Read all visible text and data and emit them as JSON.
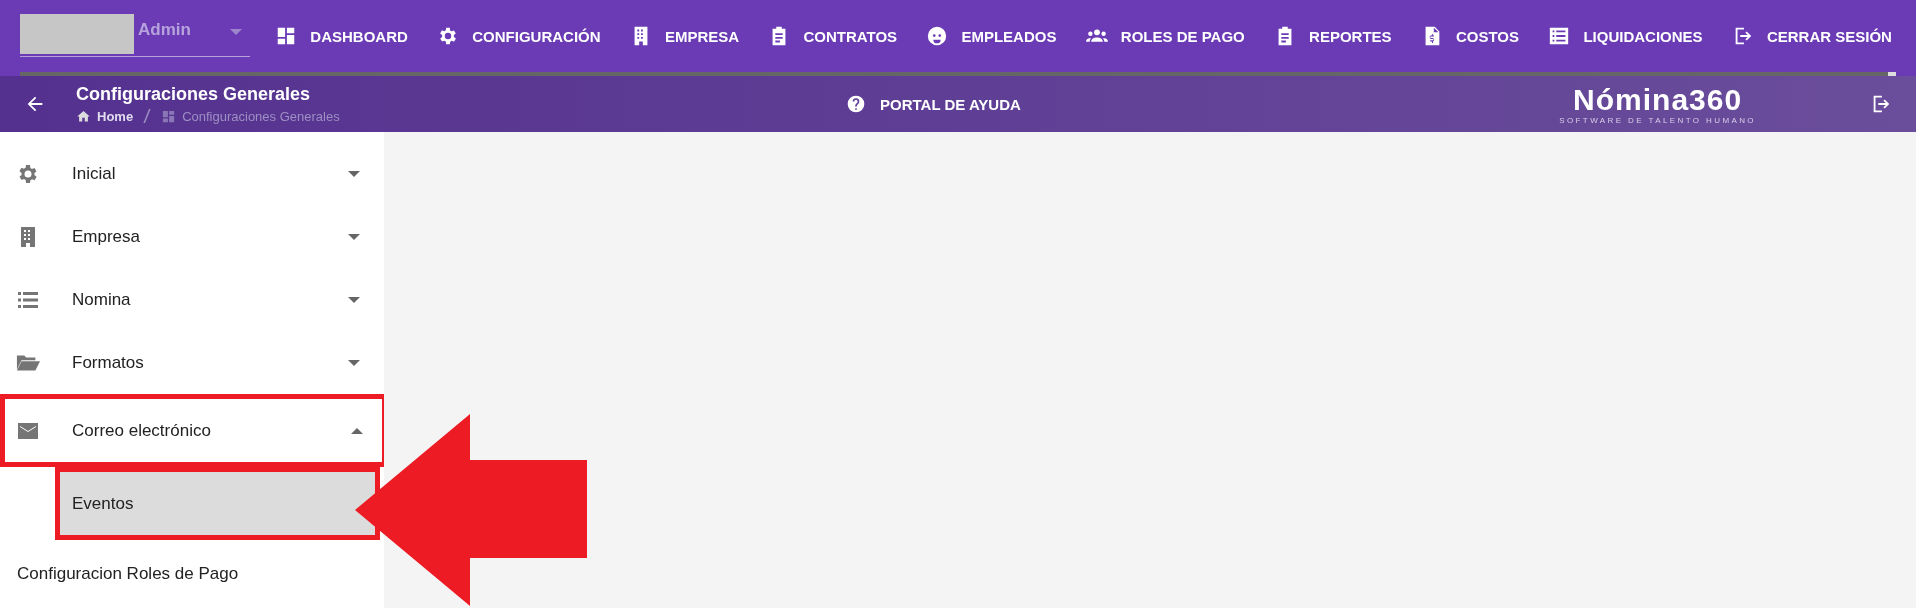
{
  "top_nav": {
    "user": {
      "label": "Admin"
    },
    "items": [
      {
        "label": "DASHBOARD"
      },
      {
        "label": "CONFIGURACIÓN"
      },
      {
        "label": "EMPRESA"
      },
      {
        "label": "CONTRATOS"
      },
      {
        "label": "EMPLEADOS"
      },
      {
        "label": "ROLES DE PAGO"
      },
      {
        "label": "REPORTES"
      },
      {
        "label": "COSTOS"
      },
      {
        "label": "LIQUIDACIONES"
      },
      {
        "label": "CERRAR SESIÓN"
      }
    ]
  },
  "header": {
    "title": "Configuraciones Generales",
    "breadcrumb": [
      {
        "label": "Home"
      },
      {
        "label": "Configuraciones Generales"
      }
    ],
    "help": "PORTAL DE AYUDA",
    "logo": {
      "name": "Nómina360",
      "tagline": "SOFTWARE DE TALENTO HUMANO"
    }
  },
  "sidebar": {
    "items": [
      {
        "kind": "group",
        "label": "Inicial",
        "expanded": false,
        "highlighted": false
      },
      {
        "kind": "group",
        "label": "Empresa",
        "expanded": false,
        "highlighted": false
      },
      {
        "kind": "group",
        "label": "Nomina",
        "expanded": false,
        "highlighted": false
      },
      {
        "kind": "group",
        "label": "Formatos",
        "expanded": false,
        "highlighted": false
      },
      {
        "kind": "group",
        "label": "Correo electrónico",
        "expanded": true,
        "highlighted": true,
        "children": [
          {
            "label": "Eventos",
            "selected": true,
            "highlighted": true
          }
        ]
      },
      {
        "kind": "link",
        "label": "Configuracion Roles de Pago",
        "highlighted": false
      }
    ]
  },
  "annotation": {
    "arrow": true
  }
}
